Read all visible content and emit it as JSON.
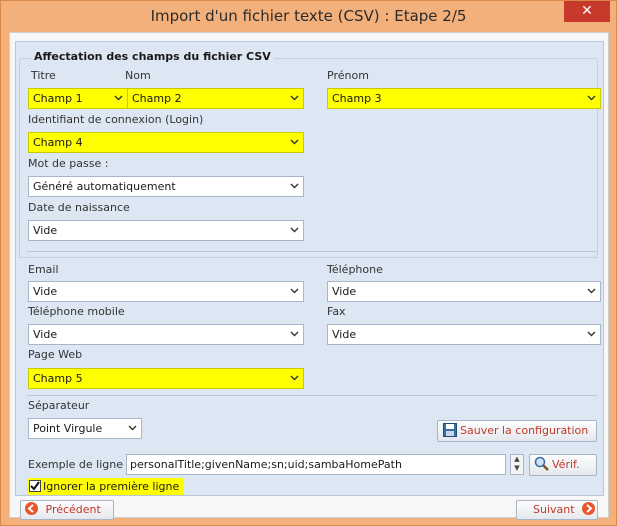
{
  "window": {
    "title": "Import d'un fichier texte (CSV) : Etape 2/5",
    "close_label": "✕"
  },
  "group": {
    "title": "Affectation des champs du fichier CSV"
  },
  "fields": {
    "titre": {
      "label": "Titre",
      "value": "Champ 1"
    },
    "nom": {
      "label": "Nom",
      "value": "Champ 2"
    },
    "prenom": {
      "label": "Prénom",
      "value": "Champ 3"
    },
    "login": {
      "label": "Identifiant de connexion (Login)",
      "value": "Champ 4"
    },
    "password": {
      "label": "Mot de passe :",
      "value": "Généré automatiquement"
    },
    "birthdate": {
      "label": "Date de naissance",
      "value": "Vide"
    },
    "email": {
      "label": "Email",
      "value": "Vide"
    },
    "telephone": {
      "label": "Téléphone",
      "value": "Vide"
    },
    "mobile": {
      "label": "Téléphone mobile",
      "value": "Vide"
    },
    "fax": {
      "label": "Fax",
      "value": "Vide"
    },
    "web": {
      "label": "Page Web",
      "value": "Champ 5"
    }
  },
  "separator": {
    "label": "Séparateur",
    "value": "Point Virgule"
  },
  "save_config": {
    "label": "Sauver la configuration"
  },
  "example": {
    "label": "Exemple de ligne :",
    "value": "personalTitle;givenName;sn;uid;sambaHomePath",
    "verify_label": "Vérif."
  },
  "ignore_first": {
    "label": "Ignorer la première ligne",
    "checked": true
  },
  "nav": {
    "prev_label": "Précédent",
    "next_label": "Suivant"
  },
  "colors": {
    "highlight": "#ffff00",
    "accent": "#e8552a",
    "panel": "#dce7f3"
  }
}
